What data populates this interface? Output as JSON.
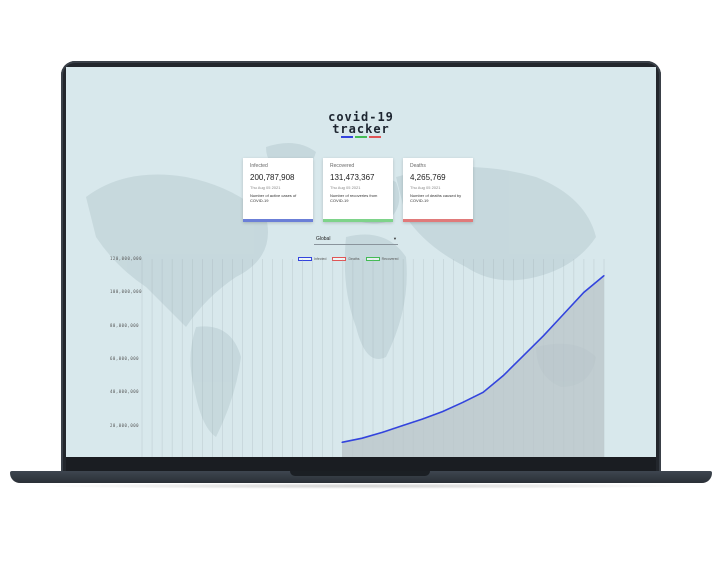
{
  "logo": {
    "line1": "covid-19",
    "line2": "tracker"
  },
  "cards": [
    {
      "title": "Infected",
      "value": "200,787,908",
      "date": "Thu Aug 05 2021",
      "description": "Number of active cases of COVID-19",
      "color": "#6b7fd7"
    },
    {
      "title": "Recovered",
      "value": "131,473,367",
      "date": "Thu Aug 05 2021",
      "description": "Number of recoveries from COVID-19",
      "color": "#7ed38a"
    },
    {
      "title": "Deaths",
      "value": "4,265,769",
      "date": "Thu Aug 05 2021",
      "description": "Number of deaths caused by COVID-19",
      "color": "#e07a7a"
    }
  ],
  "country_select": {
    "selected": "Global"
  },
  "legend": [
    {
      "label": "Infected",
      "color": "#3344dd"
    },
    {
      "label": "Deaths",
      "color": "#e05555"
    },
    {
      "label": "Recovered",
      "color": "#44bb55"
    }
  ],
  "chart_data": {
    "type": "area",
    "series": [
      {
        "name": "Infected",
        "color": "#3344dd",
        "values": [
          10000000,
          12500000,
          16000000,
          20000000,
          24000000,
          28500000,
          34000000,
          40000000,
          50000000,
          62000000,
          74000000,
          87000000,
          100000000,
          110000000
        ]
      }
    ],
    "y_ticks": [
      "120,000,000",
      "100,000,000",
      "80,000,000",
      "60,000,000",
      "40,000,000",
      "20,000,000"
    ],
    "ylim": [
      0,
      120000000
    ],
    "grid": true
  }
}
